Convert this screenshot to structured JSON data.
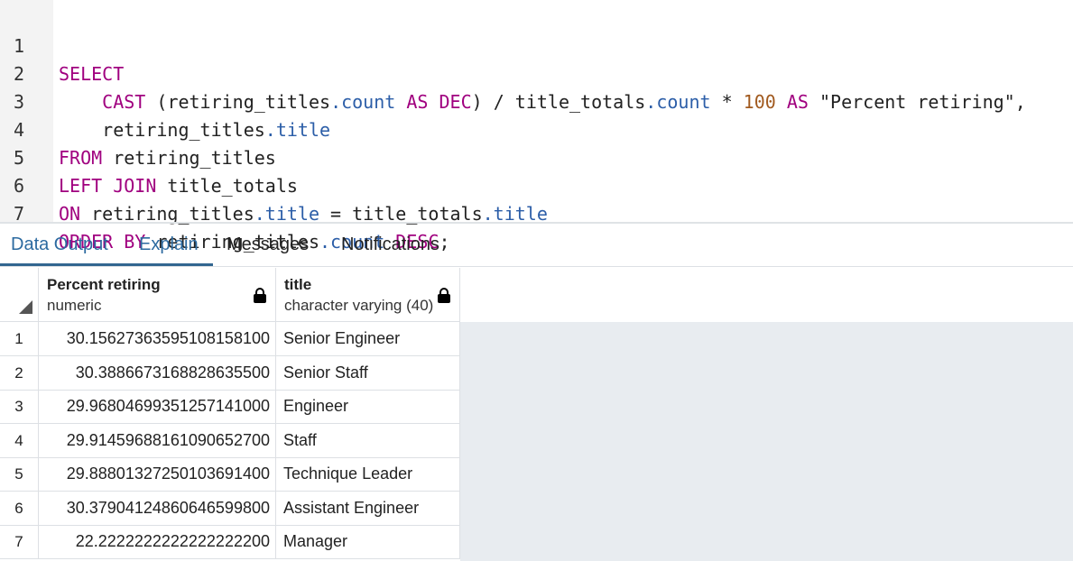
{
  "editor": {
    "line_numbers": [
      "1",
      "2",
      "3",
      "4",
      "5",
      "6",
      "7"
    ],
    "tokens": {
      "select": "SELECT",
      "cast": "CAST",
      "paren_open": " (",
      "retiring_titles": "retiring_titles",
      "dot_count": ".count",
      "as": "AS",
      "dec": "DEC",
      "paren_div": ") / ",
      "title_totals": "title_totals",
      "times": " * ",
      "hundred": "100",
      "percent_alias": "\"Percent retiring\",",
      "dot_title": ".title",
      "from": "FROM",
      "left_join": "LEFT JOIN",
      "on": "ON",
      "equals": " = ",
      "order_by": "ORDER BY",
      "desc": "DESC",
      "semicolon": ";"
    }
  },
  "tabs": [
    {
      "label": "Data Output"
    },
    {
      "label": "Explain"
    },
    {
      "label": "Messages"
    },
    {
      "label": "Notifications"
    }
  ],
  "grid": {
    "columns": [
      {
        "name": "Percent retiring",
        "type": "numeric"
      },
      {
        "name": "title",
        "type": "character varying (40)"
      }
    ],
    "rows": [
      {
        "num": "1",
        "pct": "30.1562736359510815810​0",
        "title": "Senior Engineer"
      },
      {
        "num": "2",
        "pct": "30.3886673168828635500",
        "title": "Senior Staff"
      },
      {
        "num": "3",
        "pct": "29.9680469935125714100​0",
        "title": "Engineer"
      },
      {
        "num": "4",
        "pct": "29.9145968816109065270​0",
        "title": "Staff"
      },
      {
        "num": "5",
        "pct": "29.8880132725010369140​0",
        "title": "Technique Leader"
      },
      {
        "num": "6",
        "pct": "30.3790412486064659980​0",
        "title": "Assistant Engineer"
      },
      {
        "num": "7",
        "pct": "22.2222222222222222200",
        "title": "Manager"
      }
    ]
  }
}
